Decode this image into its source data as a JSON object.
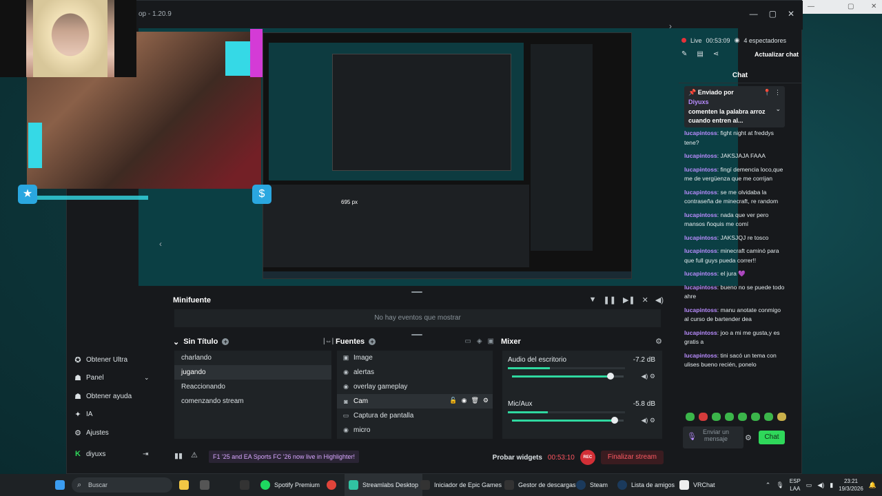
{
  "app": {
    "title_fragment": "op - 1.20.9"
  },
  "preview": {
    "px_label_1": "695 px"
  },
  "minifuente": {
    "title": "Minifuente",
    "empty": "No hay eventos que mostrar"
  },
  "sidebar": {
    "items": [
      {
        "label": "Obtener Ultra",
        "icon": "ultra-icon"
      },
      {
        "label": "Panel",
        "icon": "dashboard-icon"
      },
      {
        "label": "Obtener ayuda",
        "icon": "help-icon"
      },
      {
        "label": "IA",
        "icon": "ai-sparkle-icon"
      },
      {
        "label": "Ajustes",
        "icon": "gear-icon"
      },
      {
        "label": "diyuxs",
        "icon": "user-icon"
      }
    ]
  },
  "scenes": {
    "title": "Sin Título",
    "items": [
      "charlando",
      "jugando",
      "Reaccionando",
      "comenzando stream"
    ],
    "active": 1
  },
  "sources": {
    "title": "Fuentes",
    "items": [
      "Image",
      "alertas",
      "overlay gameplay",
      "Cam",
      "Captura de pantalla",
      "micro"
    ],
    "active": 3
  },
  "mixer": {
    "title": "Mixer",
    "channels": [
      {
        "name": "Audio del escritorio",
        "db": "-7.2 dB",
        "level": 0.36,
        "volume": 0.88
      },
      {
        "name": "Mic/Aux",
        "db": "-5.8 dB",
        "level": 0.34,
        "volume": 0.92
      }
    ]
  },
  "footer": {
    "notice": "F1 '25 and EA Sports FC '26 now live in Highlighter!",
    "test_widgets": "Probar widgets",
    "timer": "00:53:10",
    "rec": "REC",
    "end": "Finalizar stream"
  },
  "chat": {
    "live": "Live",
    "live_time": "00:53:09",
    "viewers": "4 espectadores",
    "update": "Actualizar chat",
    "title": "Chat",
    "pinned_by": "Enviado por",
    "pinned_user": "Diyuxs",
    "pinned_msg": "comenten la palabra arroz cuando entren al...",
    "messages": [
      {
        "user": "lucapintoss",
        "text": "fight night at freddys tene?"
      },
      {
        "user": "lucapintoss",
        "text": "JAKSJAJA FAAA"
      },
      {
        "user": "lucapintoss",
        "text": "fingí demencia loco,que me de vergüenza que me corrijan"
      },
      {
        "user": "lucapintoss",
        "text": "se me olvidaba la contraseña de minecraft, re random"
      },
      {
        "user": "lucapintoss",
        "text": "nada que ver pero mansos ñoquis me comí"
      },
      {
        "user": "lucapintoss",
        "text": "JAKSJQJ re tosco"
      },
      {
        "user": "lucapintoss",
        "text": "minecraft caminó para que full guys pueda correr!!"
      },
      {
        "user": "lucapintoss",
        "text": "el jura 💜"
      },
      {
        "user": "lucapintoss",
        "text": "bueno no se puede todo ahre"
      },
      {
        "user": "lucapintoss",
        "text": "manu anotate conmigo al curso de bartender dea"
      },
      {
        "user": "lucapintoss",
        "text": "joo a mi me gusta,y es gratis a"
      },
      {
        "user": "lucapintoss",
        "text": "tini sacó un tema con ulises bueno recién, ponelo"
      }
    ],
    "input_placeholder": "Enviar un mensaje",
    "send": "Chat"
  },
  "taskbar": {
    "search": "Buscar",
    "items": [
      "Spotify Premium",
      "Streamlabs Desktop",
      "Iniciador de Epic Games",
      "Gestor de descargas",
      "Steam",
      "Lista de amigos",
      "VRChat"
    ],
    "lang": "ESP",
    "lang2": "LAA",
    "time": "23:21",
    "date": "19/3/2026"
  }
}
